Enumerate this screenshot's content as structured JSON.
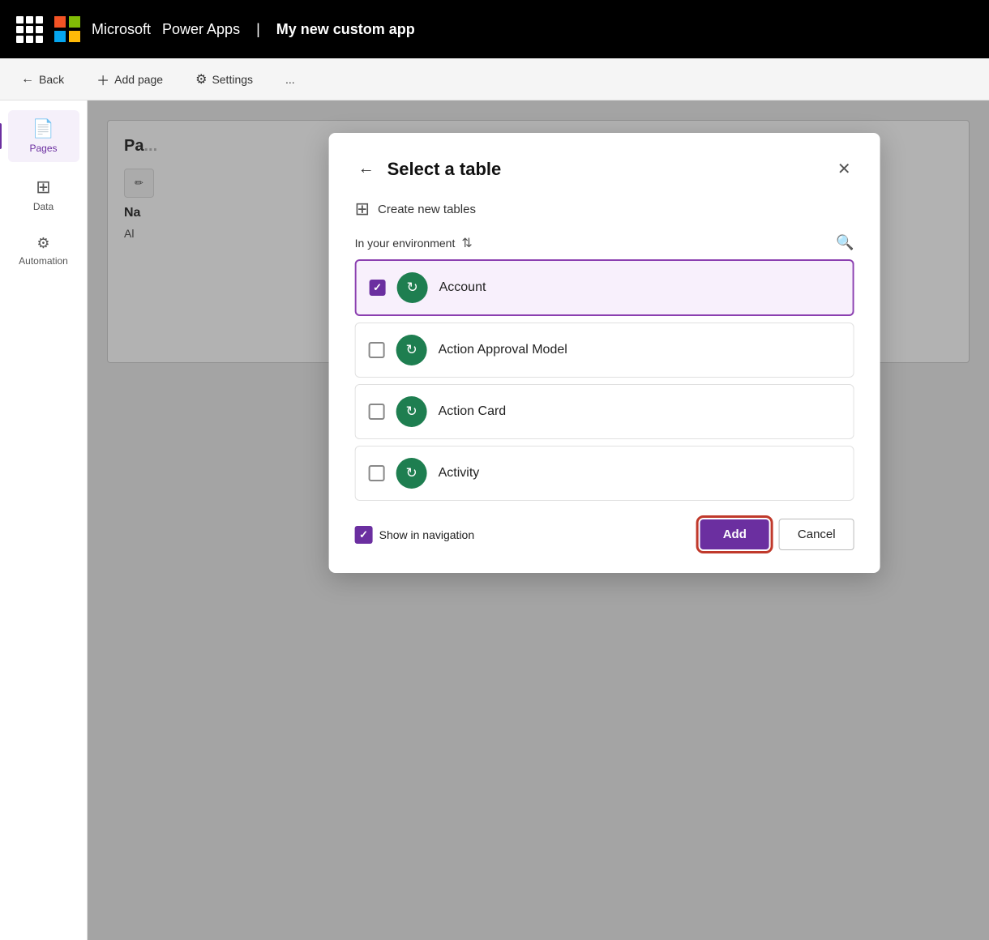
{
  "topbar": {
    "app_name": "Power Apps",
    "separator": "|",
    "project_name": "My new custom app"
  },
  "toolbar": {
    "back_label": "Back",
    "add_page_label": "Add page",
    "settings_label": "Settings",
    "more_label": "..."
  },
  "sidebar": {
    "items": [
      {
        "id": "pages",
        "label": "Pages",
        "icon": "📄",
        "active": true
      },
      {
        "id": "data",
        "label": "Data",
        "icon": "⊞",
        "active": false
      },
      {
        "id": "automation",
        "label": "Automation",
        "icon": "⚙",
        "active": false
      }
    ]
  },
  "canvas": {
    "title_prefix": "Pa",
    "section_prefix": "Na",
    "sub_prefix": "Al"
  },
  "dialog": {
    "title": "Select a table",
    "back_label": "←",
    "close_label": "×",
    "create_new_label": "Create new tables",
    "environment_label": "In your environment",
    "tables": [
      {
        "id": "account",
        "name": "Account",
        "checked": true,
        "icon": "🔄"
      },
      {
        "id": "action-approval",
        "name": "Action Approval Model",
        "checked": false,
        "icon": "🔄"
      },
      {
        "id": "action-card",
        "name": "Action Card",
        "checked": false,
        "icon": "🔄"
      },
      {
        "id": "activity",
        "name": "Activity",
        "checked": false,
        "icon": "🔄"
      }
    ],
    "show_in_navigation_label": "Show in navigation",
    "show_in_navigation_checked": true,
    "add_button_label": "Add",
    "cancel_button_label": "Cancel"
  }
}
